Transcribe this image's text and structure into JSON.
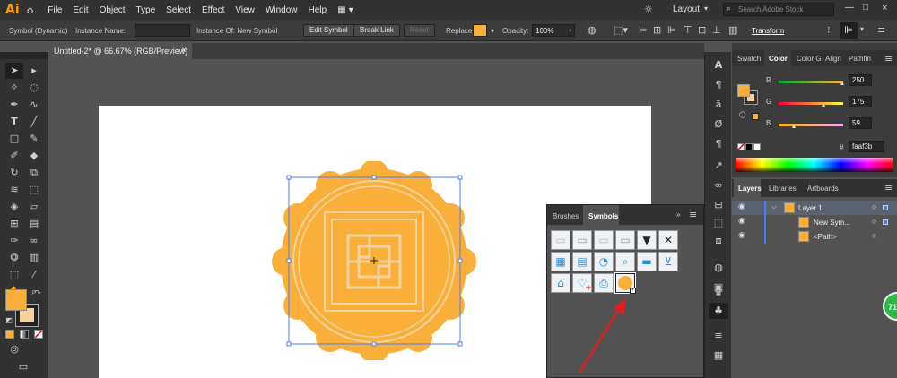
{
  "app": {
    "logo": "Ai"
  },
  "menu": [
    "File",
    "Edit",
    "Object",
    "Type",
    "Select",
    "Effect",
    "View",
    "Window",
    "Help"
  ],
  "menubar_right": {
    "layout_label": "Layout",
    "search_placeholder": "Search Adobe Stock"
  },
  "control_bar": {
    "symbol_type": "Symbol (Dynamic)",
    "instance_name_label": "Instance Name:",
    "instance_of": "Instance Of: New Symbol",
    "edit_symbol": "Edit Symbol",
    "break_link": "Break Link",
    "reset": "Reset",
    "replace_label": "Replace:",
    "opacity_label": "Opacity:",
    "opacity_value": "100%",
    "transform": "Transform"
  },
  "document_tab": {
    "title": "Untitled-2* @ 66.67% (RGB/Preview)",
    "close": "×"
  },
  "color_panel": {
    "tabs": [
      "Swatch",
      "Color",
      "Color G",
      "Align",
      "Pathfin"
    ],
    "active_tab": "Color",
    "channels": [
      {
        "label": "R",
        "value": "250",
        "fraction": 0.98
      },
      {
        "label": "G",
        "value": "175",
        "fraction": 0.69
      },
      {
        "label": "B",
        "value": "59",
        "fraction": 0.23
      }
    ],
    "hex_label": "#",
    "hex_value": "faaf3b",
    "fill_color": "#faaf3b"
  },
  "layers_panel": {
    "tabs": [
      "Layers",
      "Libraries",
      "Artboards"
    ],
    "rows": [
      {
        "name": "Layer 1"
      },
      {
        "name": "New Sym..."
      },
      {
        "name": "<Path>"
      }
    ]
  },
  "symbols_panel": {
    "tabs": [
      "Brushes",
      "Symbols"
    ],
    "active_tab": "Symbols",
    "symbols": [
      "button-1",
      "button-2",
      "button-3",
      "button-4",
      "dropdown-arrow",
      "close-x",
      "calendar",
      "film-strip",
      "rss-feed",
      "magnifier",
      "slider-bar",
      "shopping-cart",
      "home",
      "heart-plus",
      "printer",
      "new-symbol"
    ]
  },
  "zoom_badge": "71"
}
